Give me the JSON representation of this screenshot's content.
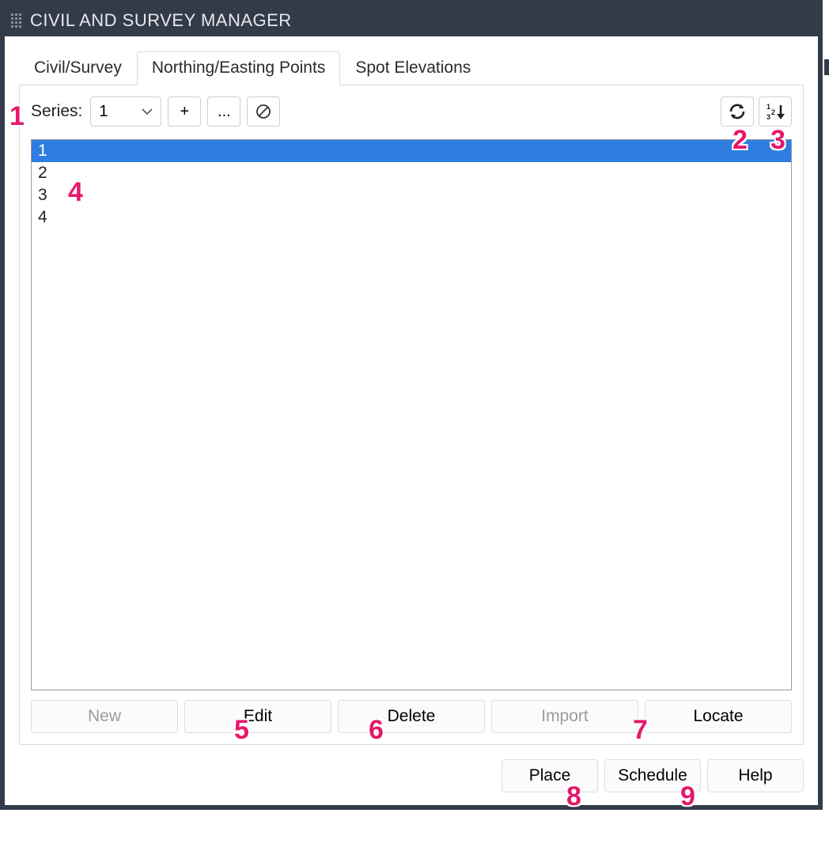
{
  "window": {
    "title": "CIVIL AND SURVEY MANAGER"
  },
  "tabs": [
    {
      "label": "Civil/Survey",
      "active": false
    },
    {
      "label": "Northing/Easting Points",
      "active": true
    },
    {
      "label": "Spot Elevations",
      "active": false
    }
  ],
  "toolbar": {
    "series_label": "Series:",
    "series_value": "1",
    "add_label": "+",
    "more_label": "...",
    "cancel_icon": "no-entry",
    "refresh_icon": "refresh",
    "renumber_icon": "renumber"
  },
  "list": {
    "items": [
      "1",
      "2",
      "3",
      "4"
    ],
    "selected_index": 0
  },
  "buttons": {
    "new": "New",
    "edit": "Edit",
    "delete": "Delete",
    "import": "Import",
    "locate": "Locate",
    "place": "Place",
    "schedule": "Schedule",
    "help": "Help"
  },
  "disabled_buttons": [
    "new",
    "import"
  ],
  "annotations": {
    "1": "1",
    "2": "2",
    "3": "3",
    "4": "4",
    "5": "5",
    "6": "6",
    "7": "7",
    "8": "8",
    "9": "9"
  }
}
